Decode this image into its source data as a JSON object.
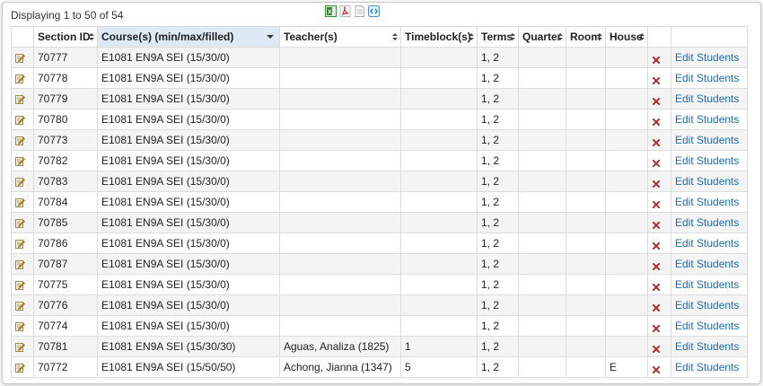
{
  "summary": "Displaying 1 to 50 of 54",
  "exports": [
    {
      "name": "excel-export-icon"
    },
    {
      "name": "pdf-export-icon"
    },
    {
      "name": "text-export-icon"
    },
    {
      "name": "xml-export-icon"
    }
  ],
  "columns": {
    "section_id": "Section ID",
    "courses": "Course(s) (min/max/filled)",
    "teachers": "Teacher(s)",
    "timeblock": "Timeblock(s)",
    "terms": "Terms",
    "quarter": "Quarter",
    "room": "Room",
    "house": "House"
  },
  "edit_students_label": "Edit Students",
  "rows": [
    {
      "id": "70777",
      "course": "E1081 EN9A SEI (15/30/0)",
      "teacher": "",
      "timeblock": "",
      "terms": "1, 2",
      "quarter": "",
      "room": "",
      "house": ""
    },
    {
      "id": "70778",
      "course": "E1081 EN9A SEI (15/30/0)",
      "teacher": "",
      "timeblock": "",
      "terms": "1, 2",
      "quarter": "",
      "room": "",
      "house": ""
    },
    {
      "id": "70779",
      "course": "E1081 EN9A SEI (15/30/0)",
      "teacher": "",
      "timeblock": "",
      "terms": "1, 2",
      "quarter": "",
      "room": "",
      "house": ""
    },
    {
      "id": "70780",
      "course": "E1081 EN9A SEI (15/30/0)",
      "teacher": "",
      "timeblock": "",
      "terms": "1, 2",
      "quarter": "",
      "room": "",
      "house": ""
    },
    {
      "id": "70773",
      "course": "E1081 EN9A SEI (15/30/0)",
      "teacher": "",
      "timeblock": "",
      "terms": "1, 2",
      "quarter": "",
      "room": "",
      "house": ""
    },
    {
      "id": "70782",
      "course": "E1081 EN9A SEI (15/30/0)",
      "teacher": "",
      "timeblock": "",
      "terms": "1, 2",
      "quarter": "",
      "room": "",
      "house": ""
    },
    {
      "id": "70783",
      "course": "E1081 EN9A SEI (15/30/0)",
      "teacher": "",
      "timeblock": "",
      "terms": "1, 2",
      "quarter": "",
      "room": "",
      "house": ""
    },
    {
      "id": "70784",
      "course": "E1081 EN9A SEI (15/30/0)",
      "teacher": "",
      "timeblock": "",
      "terms": "1, 2",
      "quarter": "",
      "room": "",
      "house": ""
    },
    {
      "id": "70785",
      "course": "E1081 EN9A SEI (15/30/0)",
      "teacher": "",
      "timeblock": "",
      "terms": "1, 2",
      "quarter": "",
      "room": "",
      "house": ""
    },
    {
      "id": "70786",
      "course": "E1081 EN9A SEI (15/30/0)",
      "teacher": "",
      "timeblock": "",
      "terms": "1, 2",
      "quarter": "",
      "room": "",
      "house": ""
    },
    {
      "id": "70787",
      "course": "E1081 EN9A SEI (15/30/0)",
      "teacher": "",
      "timeblock": "",
      "terms": "1, 2",
      "quarter": "",
      "room": "",
      "house": ""
    },
    {
      "id": "70775",
      "course": "E1081 EN9A SEI (15/30/0)",
      "teacher": "",
      "timeblock": "",
      "terms": "1, 2",
      "quarter": "",
      "room": "",
      "house": ""
    },
    {
      "id": "70776",
      "course": "E1081 EN9A SEI (15/30/0)",
      "teacher": "",
      "timeblock": "",
      "terms": "1, 2",
      "quarter": "",
      "room": "",
      "house": ""
    },
    {
      "id": "70774",
      "course": "E1081 EN9A SEI (15/30/0)",
      "teacher": "",
      "timeblock": "",
      "terms": "1, 2",
      "quarter": "",
      "room": "",
      "house": ""
    },
    {
      "id": "70781",
      "course": "E1081 EN9A SEI (15/30/30)",
      "teacher": "Aguas, Analiza (1825)",
      "timeblock": "1",
      "terms": "1, 2",
      "quarter": "",
      "room": "",
      "house": ""
    },
    {
      "id": "70772",
      "course": "E1081 EN9A SEI (15/50/50)",
      "teacher": "Achong, Jianna (1347)",
      "timeblock": "5",
      "terms": "1, 2",
      "quarter": "",
      "room": "",
      "house": "E"
    }
  ]
}
